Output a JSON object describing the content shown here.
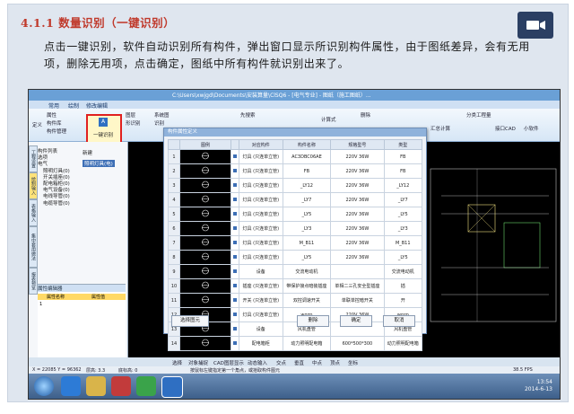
{
  "slide": {
    "heading": "4.1.1 数量识别（一键识别）",
    "paragraph": "点击一键识别，软件自动识别所有构件，弹出窗口显示所识别构件属性，由于图纸差异，会有无用项，删除无用项，点击确定，图纸中所有构件就识别出来了。"
  },
  "app": {
    "title": "C:\\Users\\xwjgd\\Documents\\安装算量\\ClSQ6 - [电气专业] - 图纸（施工图纸）...",
    "tabs": [
      "常用",
      "绘制",
      "修改编辑"
    ],
    "ribbon_buttons": [
      "属性",
      "构件库",
      "构件管理",
      "定义",
      "一键识别",
      "图层",
      "系统图",
      "形识别",
      "图层",
      "识别",
      "先搜索",
      "计算式",
      "删除",
      "汇总计算",
      "分类工程量",
      "接口CAD",
      "小软件"
    ],
    "one_key_label": "一键识别",
    "tree_title": "构件列表",
    "tree_items": [
      "选项",
      "电气",
      "照明灯具(0)",
      "开关插座(0)",
      "配电箱柜(0)",
      "电气设备(0)",
      "电线导管(0)",
      "电缆导管(0)"
    ],
    "tree_new": "新建",
    "tree_selected": "照明灯具(电)",
    "left_tabs": [
      "工程设置",
      "绘制输入",
      "表格输入",
      "集中套用做法",
      "报表预览"
    ],
    "property_panel_title": "属性编辑器",
    "property_cols": [
      "属性名称",
      "属性值"
    ],
    "property_row": "1"
  },
  "dialog": {
    "title": "构件属性定义",
    "columns": [
      "",
      "图例",
      "对应构件",
      "构件名称",
      "规格型号",
      "类型"
    ],
    "rows": [
      {
        "num": "1",
        "comp": "灯具 (只连单立管)",
        "name": "AC3DBC06AE",
        "spec": "220V 36W",
        "type": "FB"
      },
      {
        "num": "2",
        "comp": "灯具 (只连单立管)",
        "name": "FB",
        "spec": "220V 36W",
        "type": "FB"
      },
      {
        "num": "3",
        "comp": "灯具 (只连单立管)",
        "name": "_LY12",
        "spec": "220V 36W",
        "type": "_LY12"
      },
      {
        "num": "4",
        "comp": "灯具 (只连单立管)",
        "name": "_LY7",
        "spec": "220V 36W",
        "type": "_LY7"
      },
      {
        "num": "5",
        "comp": "灯具 (只连单立管)",
        "name": "_LY5",
        "spec": "220V 36W",
        "type": "_LY5"
      },
      {
        "num": "6",
        "comp": "灯具 (只连单立管)",
        "name": "_LY3",
        "spec": "220V 36W",
        "type": "_LY3"
      },
      {
        "num": "7",
        "comp": "灯具 (只连单立管)",
        "name": "M_B11",
        "spec": "220V 36W",
        "type": "M_B11"
      },
      {
        "num": "8",
        "comp": "灯具 (只连单立管)",
        "name": "_LY5",
        "spec": "220V 36W",
        "type": "_LY5"
      },
      {
        "num": "9",
        "comp": "设备",
        "name": "交流电动机",
        "spec": "",
        "type": "交流电动机"
      },
      {
        "num": "10",
        "comp": "插座 (只连单立管)",
        "name": "带保护接点暗装插座",
        "spec": "单相二三孔安全型插座",
        "type": "插"
      },
      {
        "num": "11",
        "comp": "开关 (只连单立管)",
        "name": "双控调速开关",
        "spec": "单联单控暗开关",
        "type": "开"
      },
      {
        "num": "12",
        "comp": "灯具 (只连单立管)",
        "name": "wgzp",
        "spec": "220V 36W",
        "type": "wgzp"
      },
      {
        "num": "13",
        "comp": "设备",
        "name": "风机盘管",
        "spec": "",
        "type": "风机盘管"
      },
      {
        "num": "14",
        "comp": "配电箱柜",
        "name": "动力照明配电箱",
        "spec": "600*500*300",
        "type": "动力照明配电箱"
      }
    ],
    "buttons": {
      "select_legend": "选择图元",
      "delete": "删除",
      "ok": "确定",
      "cancel": "取消"
    }
  },
  "status": {
    "tabs": [
      "选择",
      "对象捕捉",
      "CAD图层显示",
      "动态输入",
      "交点",
      "垂直",
      "中点",
      "顶点",
      "坐标"
    ],
    "coords": "X = 22085 Y = 96362",
    "floor": "层高: 3.3",
    "bottom": "底标高: 0",
    "hint": "按鼠标左键指定第一个角点，或拾取构件图元",
    "fps": "38.5 FPS"
  },
  "taskbar": {
    "time": "13:54",
    "date": "2014-6-13"
  },
  "colors": {
    "heading": "#c0392b",
    "highlight_border": "#e02020",
    "ribbon_blue": "#6aa0d6"
  }
}
